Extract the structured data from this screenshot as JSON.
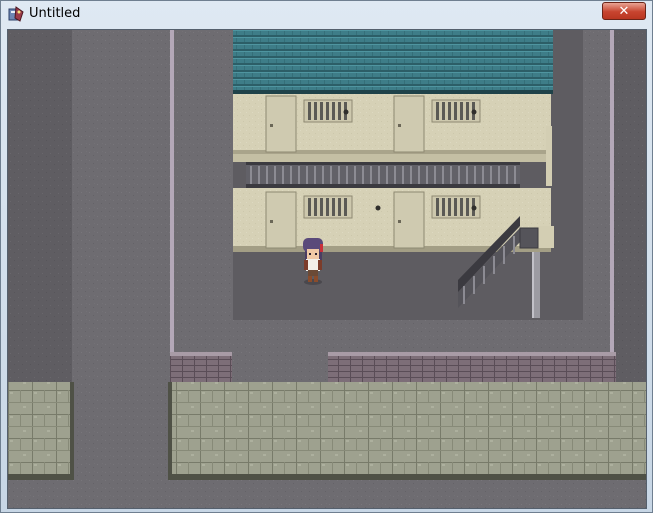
{
  "window": {
    "title": "Untitled",
    "close_glyph": "✕",
    "app_icon": "rpg-maker-icon"
  },
  "colors": {
    "ground": "#6f6d72",
    "roof": "#3f7f8a",
    "wall": "#d8d3b9",
    "wall_shadow": "#b9b49a",
    "tile": "#9da08f",
    "close_button": "#c7442f"
  }
}
